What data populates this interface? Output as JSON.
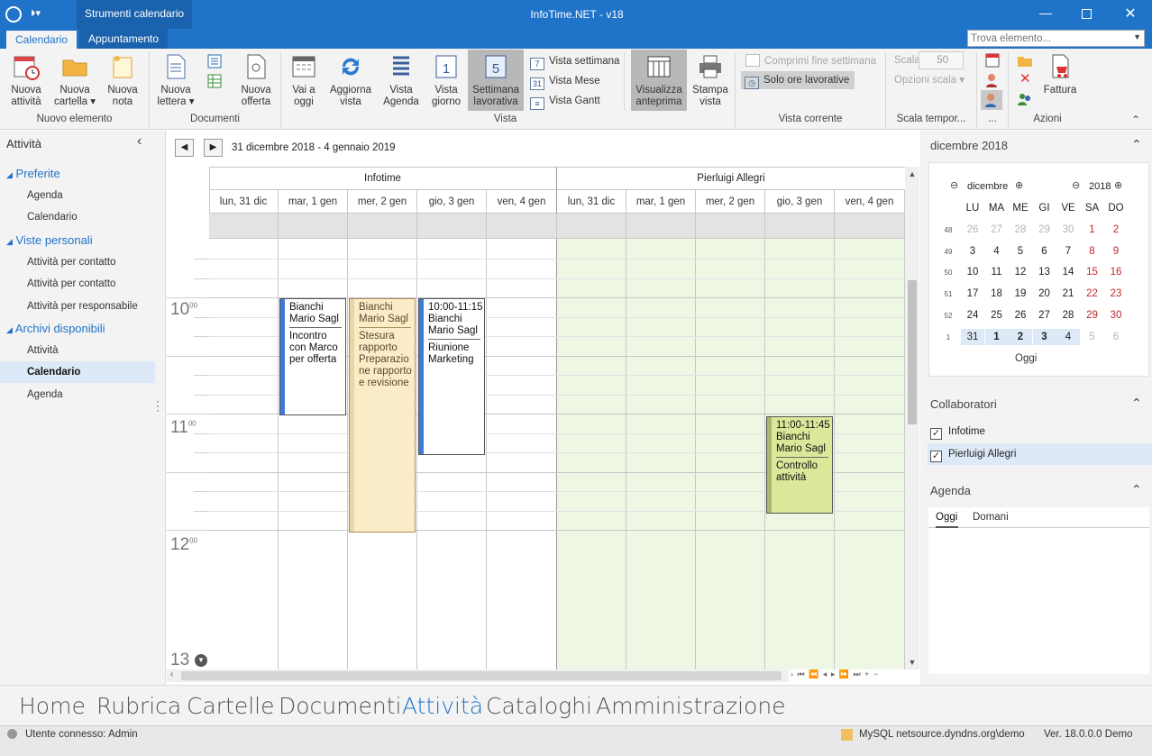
{
  "window": {
    "title": "InfoTime.NET - v18",
    "context_tab": "Strumenti calendario"
  },
  "tabs": [
    {
      "label": "Calendario"
    },
    {
      "label": "Appuntamento"
    }
  ],
  "search": {
    "placeholder": "Trova elemento..."
  },
  "ribbon": {
    "nuovo": [
      {
        "l1": "Nuova",
        "l2": "attività"
      },
      {
        "l1": "Nuova",
        "l2": "cartella ▾"
      },
      {
        "l1": "Nuova",
        "l2": "nota"
      }
    ],
    "documenti": [
      {
        "l1": "Nuova",
        "l2": "lettera ▾"
      },
      {
        "l1": "Nuova",
        "l2": "offerta"
      }
    ],
    "vista": [
      {
        "l1": "Vai a",
        "l2": "oggi"
      },
      {
        "l1": "Aggiorna",
        "l2": "vista"
      },
      {
        "l1": "Vista",
        "l2": "Agenda"
      },
      {
        "l1": "Vista",
        "l2": "giorno"
      },
      {
        "l1": "Settimana",
        "l2": "lavorativa"
      }
    ],
    "vista_small": [
      "Vista settimana",
      "Vista Mese",
      "Vista Gantt"
    ],
    "vista_icons": [
      "7",
      "31",
      "≡"
    ],
    "vista_big_badge": "5",
    "giorno_badge": "1",
    "preview": [
      {
        "l1": "Visualizza",
        "l2": "anteprima"
      },
      {
        "l1": "Stampa",
        "l2": "vista"
      }
    ],
    "corrente": [
      "Comprimi fine settimana",
      "Solo ore lavorative"
    ],
    "scala": {
      "label": "Scala",
      "value": "50",
      "options": "Opzioni scala ▾"
    },
    "fattura": "Fattura",
    "groups": [
      "Nuovo elemento",
      "Documenti",
      "Vista",
      "Vista corrente",
      "Scala tempor...",
      "...",
      "Azioni"
    ]
  },
  "leftnav": {
    "title": "Attività",
    "sections": [
      {
        "label": "Preferite",
        "items": [
          "Agenda",
          "Calendario"
        ]
      },
      {
        "label": "Viste personali",
        "items": [
          "Attività per contatto",
          "Attività per contatto",
          "Attività per responsabile"
        ]
      },
      {
        "label": "Archivi disponibili",
        "items": [
          "Attività",
          "Calendario",
          "Agenda"
        ]
      }
    ]
  },
  "calendar": {
    "range": "31 dicembre 2018 - 4 gennaio 2019",
    "resources": [
      "Infotime",
      "Pierluigi Allegri"
    ],
    "days": [
      "lun, 31 dic",
      "mar, 1 gen",
      "mer, 2 gen",
      "gio, 3 gen",
      "ven, 4 gen"
    ],
    "hours": [
      {
        "h": "10",
        "m": "00"
      },
      {
        "h": "11",
        "m": "00"
      },
      {
        "h": "12",
        "m": "00"
      },
      {
        "h": "13",
        "m": ""
      }
    ],
    "appointments": [
      {
        "time": "",
        "who": "Bianchi Mario Sagl",
        "text": "Incontro con Marco per offerta"
      },
      {
        "time": "",
        "who": "Bianchi Mario Sagl",
        "text": "Stesura rapporto Preparazio ne rapporto e revisione"
      },
      {
        "time": "10:00-11:15",
        "who": "Bianchi Mario Sagl",
        "text": "Riunione Marketing"
      },
      {
        "time": "11:00-11:45",
        "who": "Bianchi Mario Sagl",
        "text": "Controllo attività"
      }
    ],
    "scroll_nav": "› ⏮ ⏪ ◂ ▸ ⏩ ⏭ + −"
  },
  "minical": {
    "header": "dicembre 2018",
    "month": "dicembre",
    "year": "2018",
    "dow": [
      "LU",
      "MA",
      "ME",
      "GI",
      "VE",
      "SA",
      "DO"
    ],
    "weeks": [
      {
        "wk": "48",
        "d": [
          "26",
          "27",
          "28",
          "29",
          "30",
          "1",
          "2"
        ]
      },
      {
        "wk": "49",
        "d": [
          "3",
          "4",
          "5",
          "6",
          "7",
          "8",
          "9"
        ]
      },
      {
        "wk": "50",
        "d": [
          "10",
          "11",
          "12",
          "13",
          "14",
          "15",
          "16"
        ]
      },
      {
        "wk": "51",
        "d": [
          "17",
          "18",
          "19",
          "20",
          "21",
          "22",
          "23"
        ]
      },
      {
        "wk": "52",
        "d": [
          "24",
          "25",
          "26",
          "27",
          "28",
          "29",
          "30"
        ]
      },
      {
        "wk": "1",
        "d": [
          "31",
          "1",
          "2",
          "3",
          "4",
          "5",
          "6"
        ]
      }
    ],
    "today": "Oggi"
  },
  "collaboratori": {
    "title": "Collaboratori",
    "items": [
      "Infotime",
      "Pierluigi Allegri"
    ]
  },
  "agenda": {
    "title": "Agenda",
    "tabs": [
      "Oggi",
      "Domani"
    ]
  },
  "bottomnav": [
    "Home",
    "Rubrica",
    "Cartelle",
    "Documenti",
    "Attività",
    "Cataloghi",
    "Amministrazione"
  ],
  "status": {
    "user": "Utente connesso: Admin",
    "db": "MySQL netsource.dyndns.org\\demo",
    "version": "Ver. 18.0.0.0 Demo"
  },
  "colors": {
    "accent": "#1f73c8",
    "working": "#eef7e4",
    "appt_yellow": "#fbecc8",
    "appt_green": "#dbe89a",
    "weekend_red": "#c0282c"
  }
}
